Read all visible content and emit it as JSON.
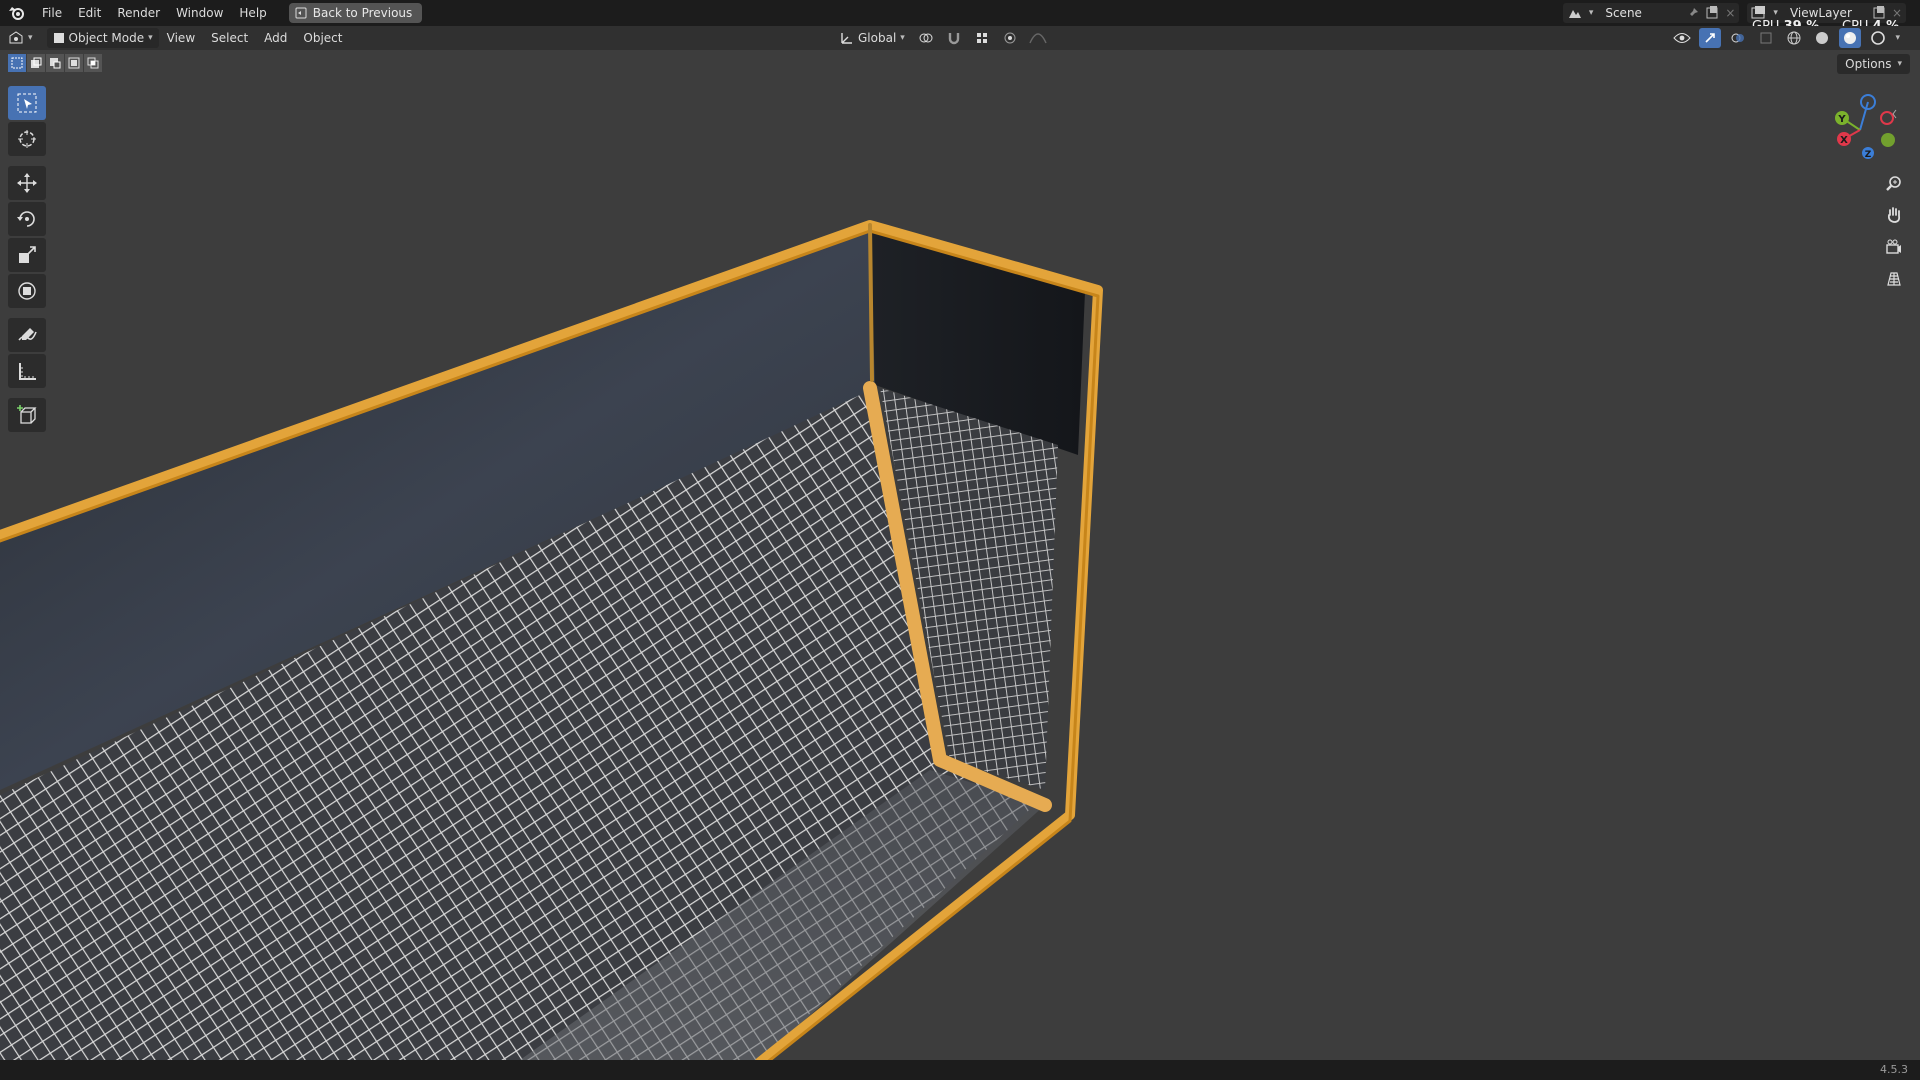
{
  "menu": {
    "items": [
      "File",
      "Edit",
      "Render",
      "Window",
      "Help"
    ],
    "back_button": "Back to Previous"
  },
  "top_right": {
    "scene": "Scene",
    "view_layer": "ViewLayer",
    "gpu_label": "GPU",
    "gpu_value": "39 %",
    "cpu_label": "CPU",
    "cpu_value": "4 %"
  },
  "header": {
    "mode": "Object Mode",
    "menus": [
      "View",
      "Select",
      "Add",
      "Object"
    ],
    "transform_orientation": "Global",
    "options_label": "Options"
  },
  "gizmo": {
    "axes": [
      "X",
      "Y",
      "Z"
    ],
    "colors": {
      "x": "#e0384a",
      "y": "#7bb22c",
      "z": "#3b7ed8",
      "accent": "#4772b3"
    }
  },
  "model": {
    "frame_color": "#e3a43a",
    "wall_color": "#2b2f36",
    "mesh_color": "#cfcfcf"
  },
  "status": {
    "version": "4.5.3"
  }
}
